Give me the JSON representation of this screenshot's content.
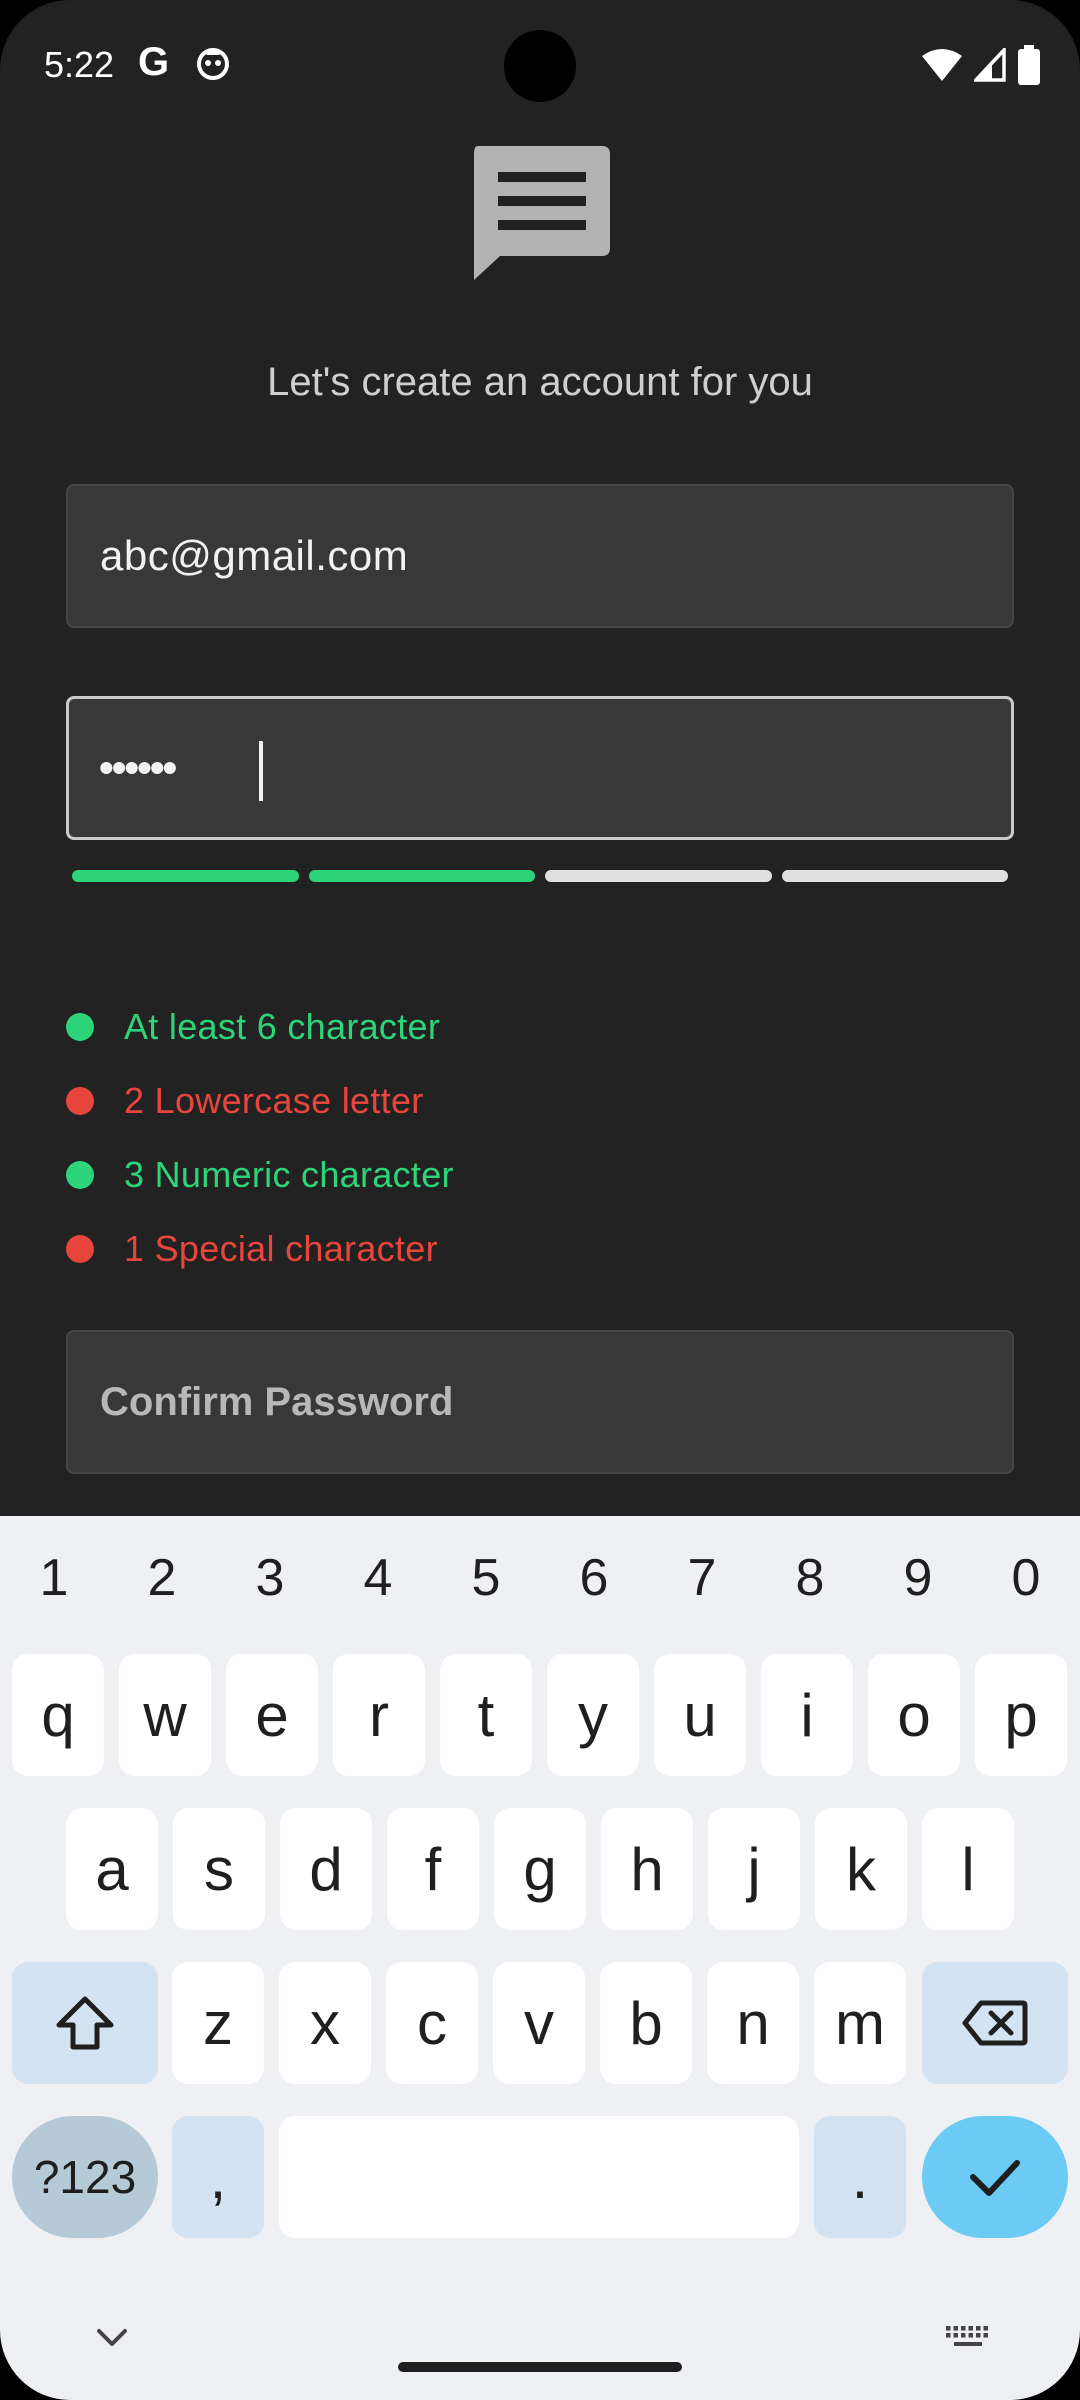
{
  "status_bar": {
    "time": "5:22",
    "google_glyph": "G",
    "icons": [
      "google-icon",
      "app-notification-icon",
      "wifi-icon",
      "signal-icon",
      "battery-icon"
    ]
  },
  "header": {
    "logo_icon": "message-icon",
    "subtitle": "Let's create an account for you"
  },
  "form": {
    "email_value": "abc@gmail.com",
    "password_masked": "••••••",
    "strength": {
      "filled_segments": 2,
      "total_segments": 4
    },
    "rules": [
      {
        "text": "At least 6 character",
        "status": "met"
      },
      {
        "text": "2 Lowercase letter",
        "status": "unmet"
      },
      {
        "text": "3 Numeric character",
        "status": "met"
      },
      {
        "text": "1 Special character",
        "status": "unmet"
      }
    ],
    "confirm_placeholder": "Confirm Password"
  },
  "keyboard": {
    "numbers": [
      "1",
      "2",
      "3",
      "4",
      "5",
      "6",
      "7",
      "8",
      "9",
      "0"
    ],
    "row1": [
      "q",
      "w",
      "e",
      "r",
      "t",
      "y",
      "u",
      "i",
      "o",
      "p"
    ],
    "row2": [
      "a",
      "s",
      "d",
      "f",
      "g",
      "h",
      "j",
      "k",
      "l"
    ],
    "row3": [
      "z",
      "x",
      "c",
      "v",
      "b",
      "n",
      "m"
    ],
    "symbols_label": "?123",
    "comma": ",",
    "period": "."
  },
  "colors": {
    "background": "#222222",
    "field": "#383838",
    "success": "#2ed47a",
    "error": "#e8453c",
    "keyboard_bg": "#eef0f3",
    "enter_key": "#6bcbf5"
  }
}
